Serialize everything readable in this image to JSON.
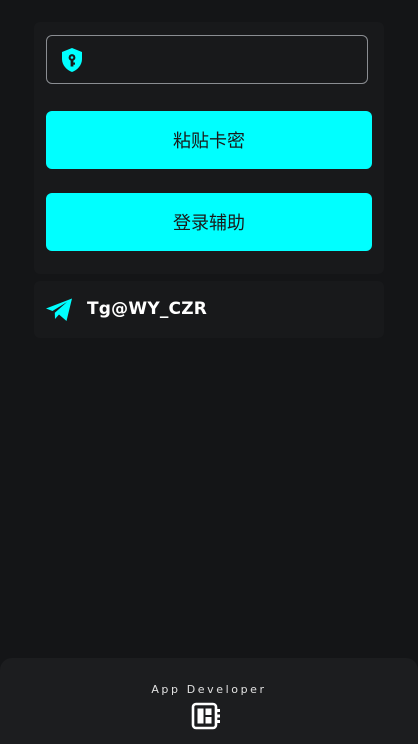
{
  "login": {
    "key_input": {
      "value": "",
      "placeholder": ""
    },
    "paste_button_label": "粘贴卡密",
    "assist_button_label": "登录辅助"
  },
  "contact": {
    "icon": "telegram-icon",
    "label": "Tg@WY_CZR"
  },
  "footer": {
    "label": "App Developer",
    "icon": "developer-board-icon"
  },
  "colors": {
    "background": "#141517",
    "card": "#18191b",
    "accent": "#00ffff",
    "text": "#ffffff",
    "button_text": "#1a1a1a"
  }
}
